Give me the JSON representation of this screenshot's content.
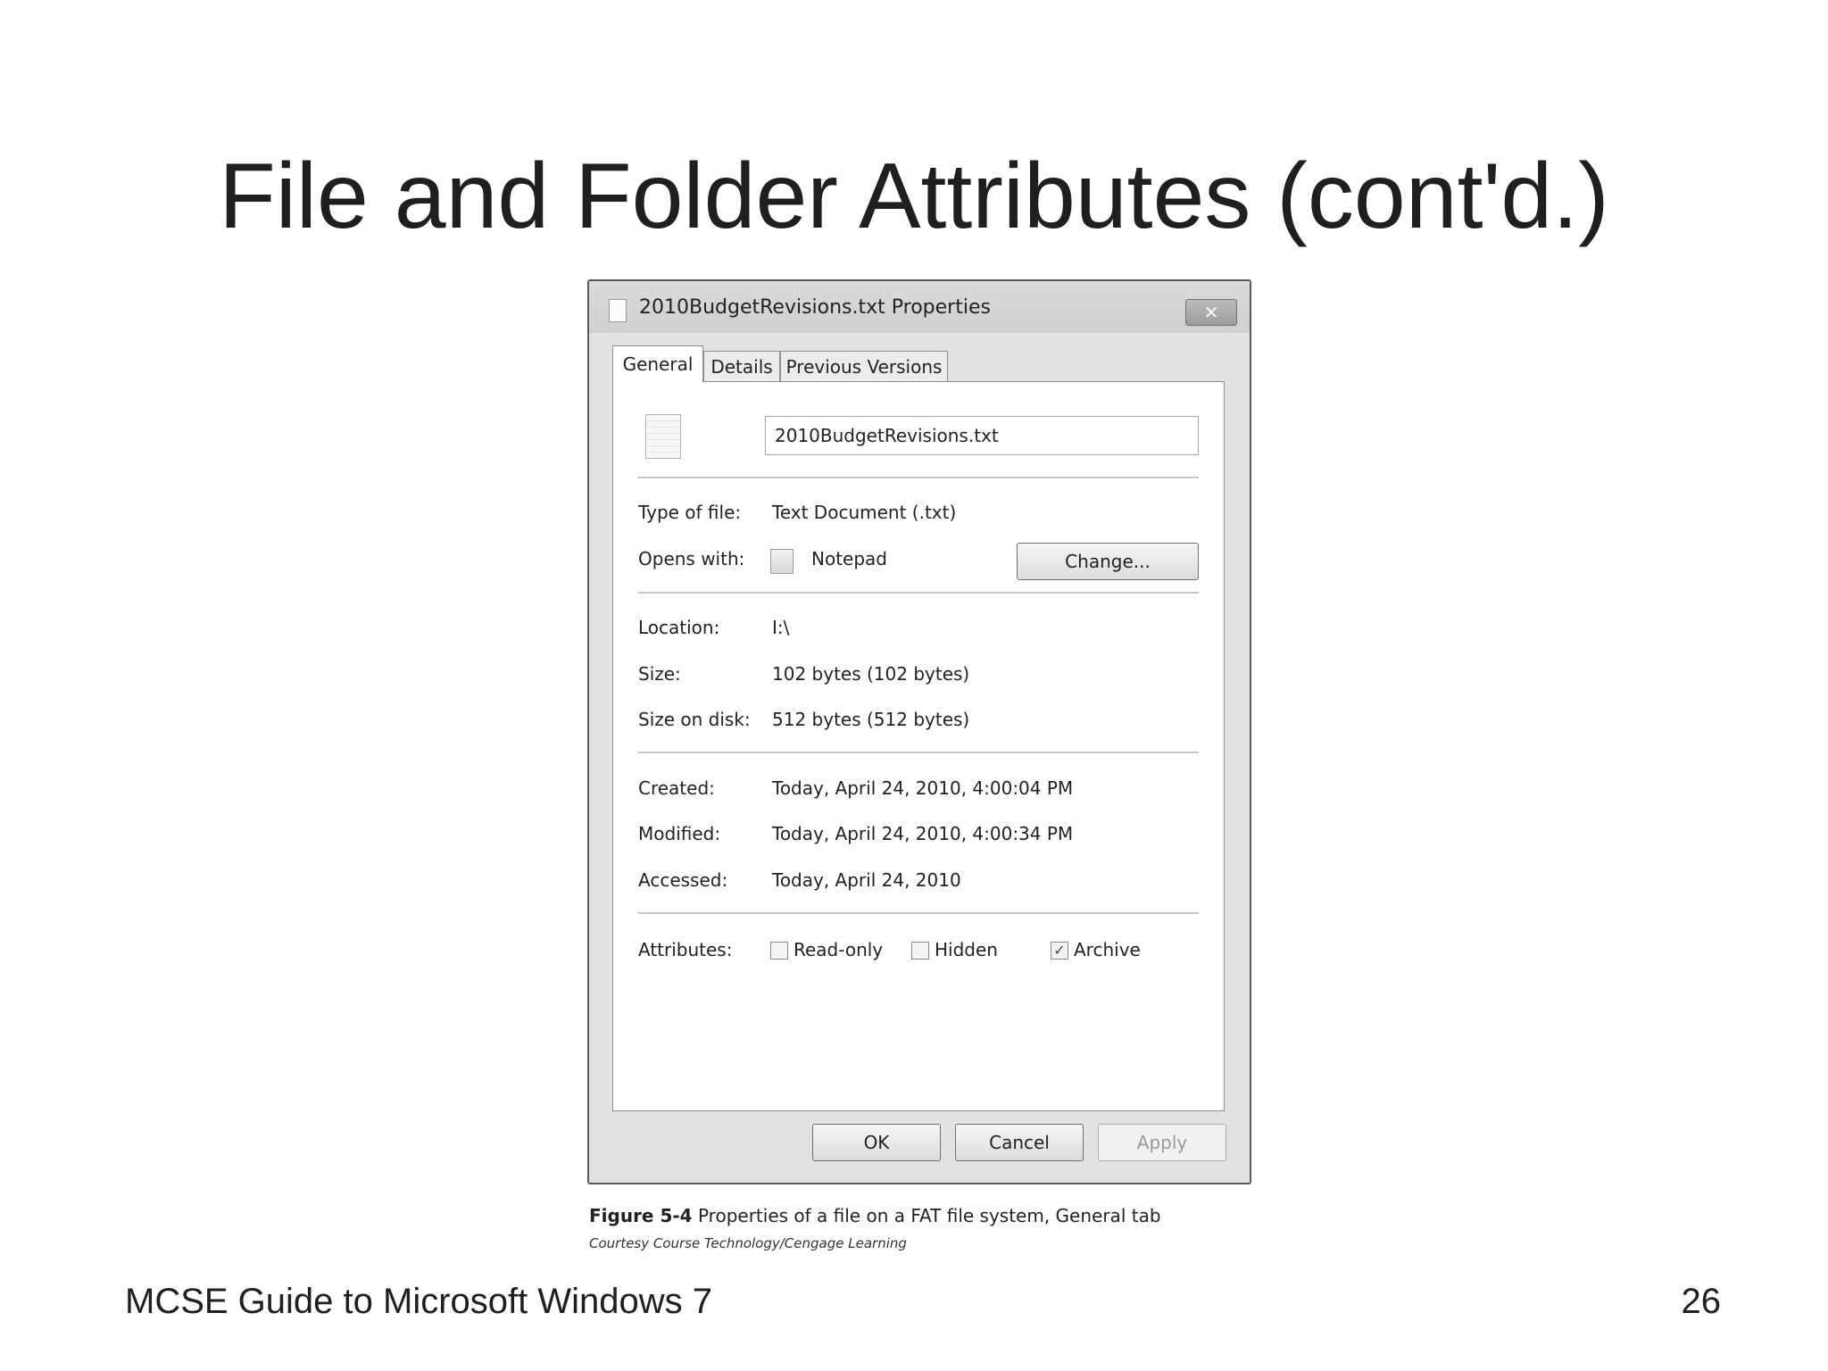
{
  "slide": {
    "title": "File and Folder Attributes (cont'd.)",
    "footer_left": "MCSE Guide to Microsoft Windows 7",
    "page_number": "26"
  },
  "dialog": {
    "title": "2010BudgetRevisions.txt Properties",
    "close_symbol": "✕",
    "tabs": [
      {
        "label": "General",
        "active": true
      },
      {
        "label": "Details",
        "active": false
      },
      {
        "label": "Previous Versions",
        "active": false
      }
    ],
    "file_name": "2010BudgetRevisions.txt",
    "rows": {
      "type_label": "Type of file:",
      "type_value": "Text Document (.txt)",
      "opens_label": "Opens with:",
      "opens_value": "Notepad",
      "change_button": "Change...",
      "location_label": "Location:",
      "location_value": "I:\\",
      "size_label": "Size:",
      "size_value": "102 bytes (102 bytes)",
      "size_disk_label": "Size on disk:",
      "size_disk_value": "512 bytes (512 bytes)",
      "created_label": "Created:",
      "created_value": "Today, April 24, 2010, 4:00:04 PM",
      "modified_label": "Modified:",
      "modified_value": "Today, April 24, 2010, 4:00:34 PM",
      "accessed_label": "Accessed:",
      "accessed_value": "Today, April 24, 2010",
      "attributes_label": "Attributes:"
    },
    "attributes": [
      {
        "label": "Read-only",
        "checked": false
      },
      {
        "label": "Hidden",
        "checked": false
      },
      {
        "label": "Archive",
        "checked": true
      }
    ],
    "buttons": {
      "ok": "OK",
      "cancel": "Cancel",
      "apply": "Apply"
    }
  },
  "figure": {
    "number": "Figure 5-4",
    "caption": "Properties of a file on a FAT file system, General tab",
    "credit": "Courtesy Course Technology/Cengage Learning"
  }
}
